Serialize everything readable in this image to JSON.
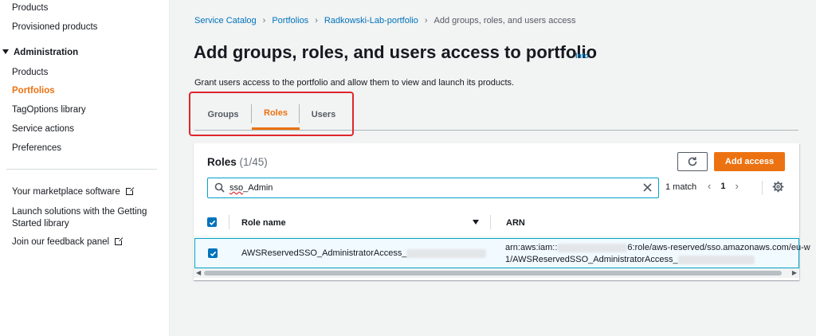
{
  "sidebar": {
    "top_items": [
      {
        "label": "Products"
      },
      {
        "label": "Provisioned products"
      }
    ],
    "section": "Administration",
    "admin_items": [
      {
        "label": "Products",
        "active": false
      },
      {
        "label": "Portfolios",
        "active": true
      },
      {
        "label": "TagOptions library",
        "active": false
      },
      {
        "label": "Service actions",
        "active": false
      },
      {
        "label": "Preferences",
        "active": false
      }
    ],
    "links": [
      {
        "label": "Your marketplace software"
      },
      {
        "label_line1": "Launch solutions with the Getting",
        "label_line2": "Started library"
      },
      {
        "label": "Join our feedback panel"
      }
    ]
  },
  "breadcrumb": {
    "items": [
      "Service Catalog",
      "Portfolios",
      "Radkowski-Lab-portfolio"
    ],
    "current": "Add groups, roles, and users access"
  },
  "page": {
    "title": "Add groups, roles, and users access to portfolio",
    "info": "Info",
    "description": "Grant users access to the portfolio and allow them to view and launch its products."
  },
  "tabs": [
    {
      "label": "Groups",
      "active": false
    },
    {
      "label": "Roles",
      "active": true
    },
    {
      "label": "Users",
      "active": false
    }
  ],
  "panel": {
    "title": "Roles",
    "count": "(1/45)",
    "add_button": "Add access",
    "search_value_prefix": "sso",
    "search_value_suffix": "_Admin",
    "match_text": "1 match",
    "page_number": "1",
    "columns": [
      "Role name",
      "ARN"
    ],
    "rows": [
      {
        "selected": true,
        "role_name": "AWSReservedSSO_AdministratorAccess_",
        "arn_line1_prefix": "arn:aws:iam::",
        "arn_line1_suffix": "6:role/aws-reserved/sso.amazonaws.com/eu-w",
        "arn_line2": "1/AWSReservedSSO_AdministratorAccess_"
      }
    ]
  },
  "colors": {
    "accent": "#ec7211",
    "link": "#0073bb",
    "focus": "#00a1c9",
    "highlight_box": "#e0262b"
  }
}
